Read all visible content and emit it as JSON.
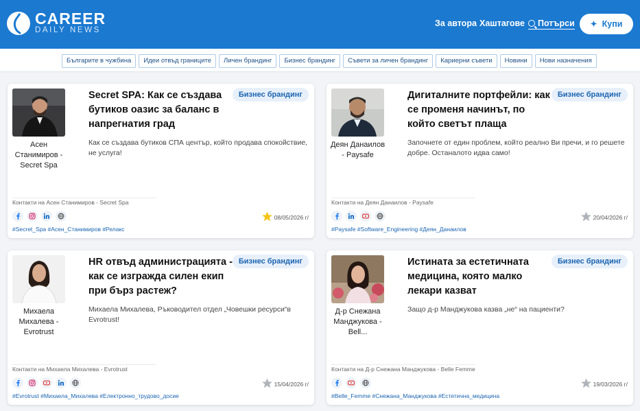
{
  "brand": {
    "title": "CAREER",
    "subtitle": "DAILY NEWS"
  },
  "nav": {
    "author": "За автора",
    "hashtags": "Хаштагове",
    "search": "Потърси",
    "buy": "Купи"
  },
  "categories": [
    "Българите в чужбина",
    "Идеи отвъд границите",
    "Личен брандинг",
    "Бизнес брандинг",
    "Съвети за личен брандинг",
    "Кариерни съвети",
    "Новини",
    "Нови назначения"
  ],
  "colors": {
    "header": "#1b79d0",
    "accent": "#1b64b0",
    "star_on": "#f5c518",
    "star_off": "#b0b4ba"
  },
  "articles": [
    {
      "title": "Secret SPA: Как се създава бутиков оазис за баланс в напрегнатия град",
      "category": "Бизнес брандинг",
      "author": "Асен Станимиров - Secret Spa",
      "excerpt": "Как се създава бутиков СПА център, който продава спокойствие, не услуга!",
      "contacts": "Контакти на Асен Станимиров - Secret Spa",
      "socials": [
        "facebook-icon",
        "instagram-icon",
        "linkedin-icon",
        "globe-icon"
      ],
      "tags": "#Secret_Spa #Асен_Станимиров #Релакс",
      "date": "08/05/2026 г/",
      "starred": true
    },
    {
      "title": "Дигиталните портфейли: как се променя начинът, по който светът плаща",
      "category": "Бизнес брандинг",
      "author": "Деян Данаилов - Paysafe",
      "excerpt": "Започнете от един проблем, който реално Ви пречи, и го решете добре. Останалото идва само!",
      "contacts": "Контакти на Деян Данаилов - Paysafe",
      "socials": [
        "facebook-icon",
        "linkedin-icon",
        "youtube-icon",
        "globe-icon"
      ],
      "tags": "#Paysafe #Software_Engineering #Деян_Данаилов",
      "date": "20/04/2026 г/",
      "starred": false
    },
    {
      "title": "HR отвъд администрацията - как се изгражда силен екип при бърз растеж?",
      "category": "Бизнес брандинг",
      "author": "Михаела Михалева - Evrotrust",
      "excerpt": "Михаела Михалева, Ръководител отдел „Човешки ресурси“в Evrotrust!",
      "contacts": "Контакти на Михаела Михалева - Evrotrust",
      "socials": [
        "facebook-icon",
        "instagram-icon",
        "youtube-icon",
        "linkedin-icon",
        "globe-icon"
      ],
      "tags": "#Evrotrust #Михаела_Михалева #Електронно_трудово_досие",
      "date": "15/04/2026 г/",
      "starred": false
    },
    {
      "title": "Истината за естетичната медицина, която малко лекари казват",
      "category": "Бизнес брандинг",
      "author": "Д-р Снежана Манджукова - Bell...",
      "excerpt": "Защо д-р Манджукова казва „не“ на пациенти?",
      "contacts": "Контакти на Д-р Снежана Манджукова - Belle Femme",
      "socials": [
        "facebook-icon",
        "youtube-icon",
        "globe-icon"
      ],
      "tags": "#Belle_Femme #Снежана_Манджукова #Естетична_медицина",
      "date": "19/03/2026 г/",
      "starred": false
    }
  ]
}
